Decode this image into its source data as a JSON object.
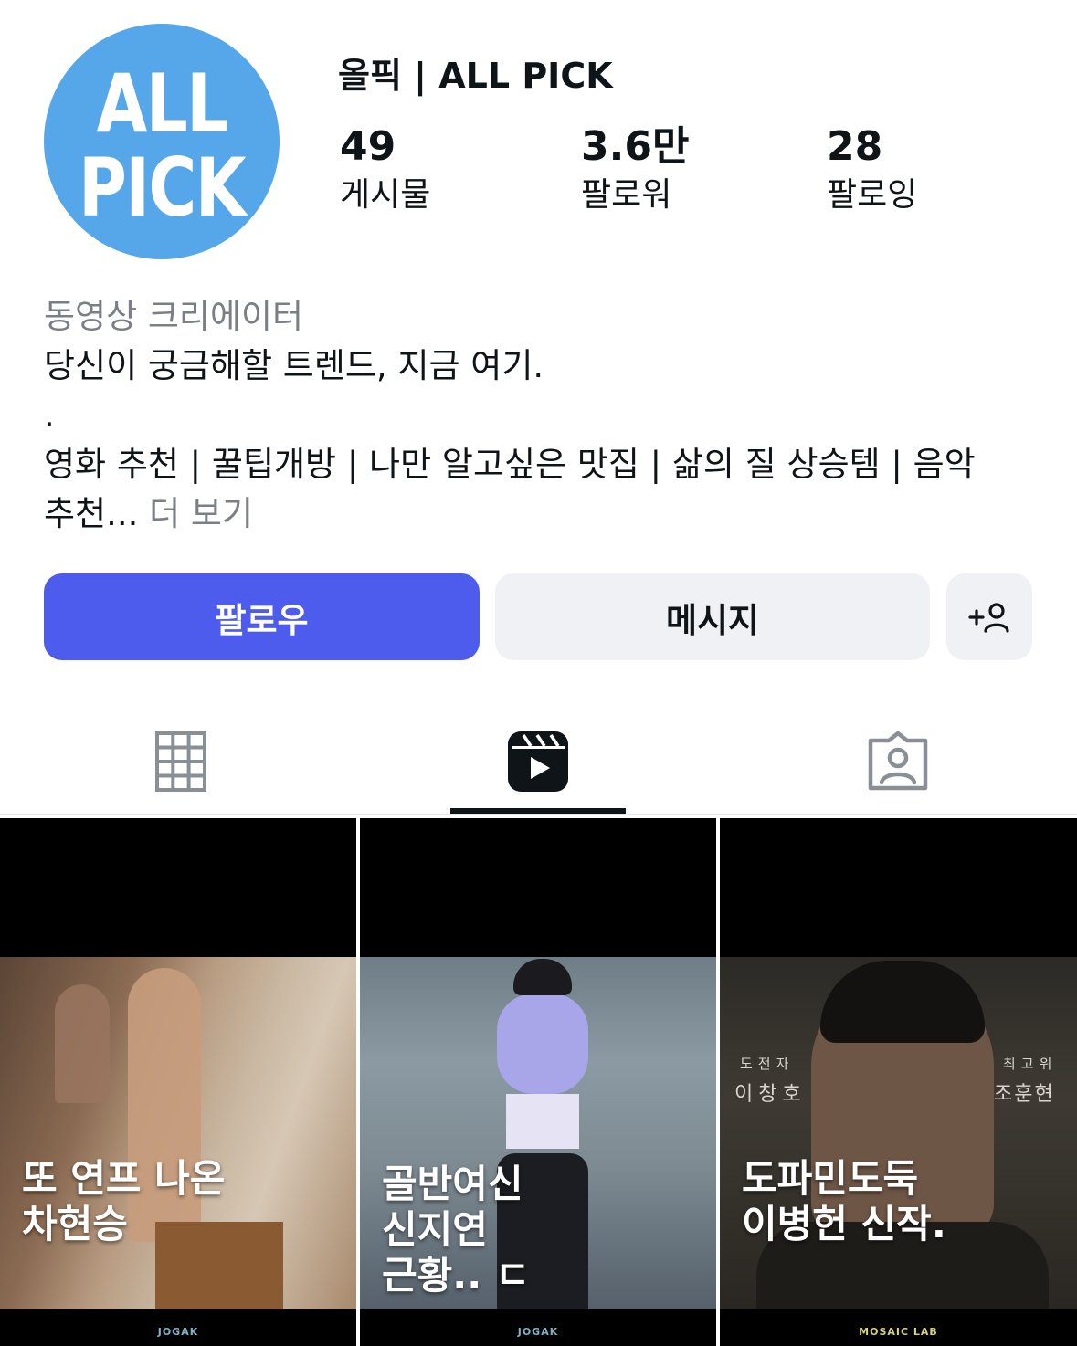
{
  "profile": {
    "avatar_line1": "ALL",
    "avatar_line2": "PICK",
    "name": "올픽 | ALL PICK"
  },
  "stats": {
    "posts_count": "49",
    "posts_label": "게시물",
    "followers_count": "3.6만",
    "followers_label": "팔로워",
    "following_count": "28",
    "following_label": "팔로잉"
  },
  "bio": {
    "category": "동영상 크리에이터",
    "line1": "당신이 궁금해할 트렌드, 지금 여기.",
    "line2": ".",
    "line3": "영화 추천 | 꿀팁개방 | 나만 알고싶은 맛집 | 삶의 질 상승템 | 음악",
    "line4": "추천...",
    "more": " 더 보기"
  },
  "actions": {
    "follow_label": "팔로우",
    "message_label": "메시지",
    "add_user_icon": "add-person-icon"
  },
  "tabs": [
    {
      "name": "grid",
      "icon": "grid-icon",
      "selected": false
    },
    {
      "name": "reels",
      "icon": "reels-icon",
      "selected": true
    },
    {
      "name": "tagged",
      "icon": "tagged-icon",
      "selected": false
    }
  ],
  "reels": [
    {
      "caption_line1": "또 연프 나온",
      "caption_line2": "차현승",
      "caption_line3": "",
      "brand": "JOGAK"
    },
    {
      "caption_line1": "골반여신",
      "caption_line2": "신지연",
      "caption_line3": "근황.. ㄷ",
      "brand": "JOGAK"
    },
    {
      "caption_line1": "도파민도둑",
      "caption_line2": "이병헌 신작.",
      "caption_line3": "",
      "brand": "MOSAIC LAB",
      "sign_left_title": "도전자",
      "sign_left_name": "이창호",
      "sign_right_title": "최고위",
      "sign_right_name": "조훈현"
    }
  ],
  "colors": {
    "avatar_bg": "#56a7ea",
    "follow_button": "#4d5cec",
    "secondary_button": "#eff1f4",
    "muted_text": "#7a7f86"
  }
}
